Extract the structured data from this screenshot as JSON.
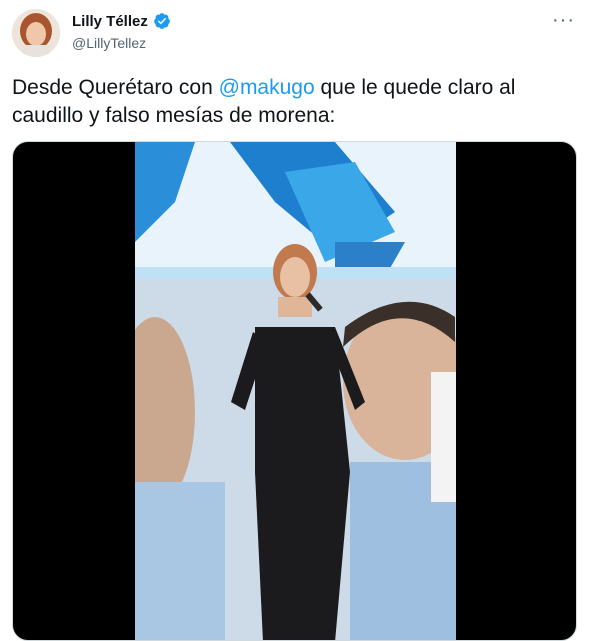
{
  "author": {
    "name": "Lilly Téllez",
    "handle": "@LillyTellez",
    "verified": true
  },
  "tweet": {
    "text_before": "Desde Querétaro con ",
    "mention": "@makugo",
    "text_after": " que le quede claro al caudillo y falso mesías de morena:"
  },
  "icons": {
    "more": "more-horizontal-icon",
    "verified": "verified-badge-icon"
  },
  "colors": {
    "accent": "#1d9bf0",
    "text": "#0f1419",
    "secondary": "#536471"
  }
}
